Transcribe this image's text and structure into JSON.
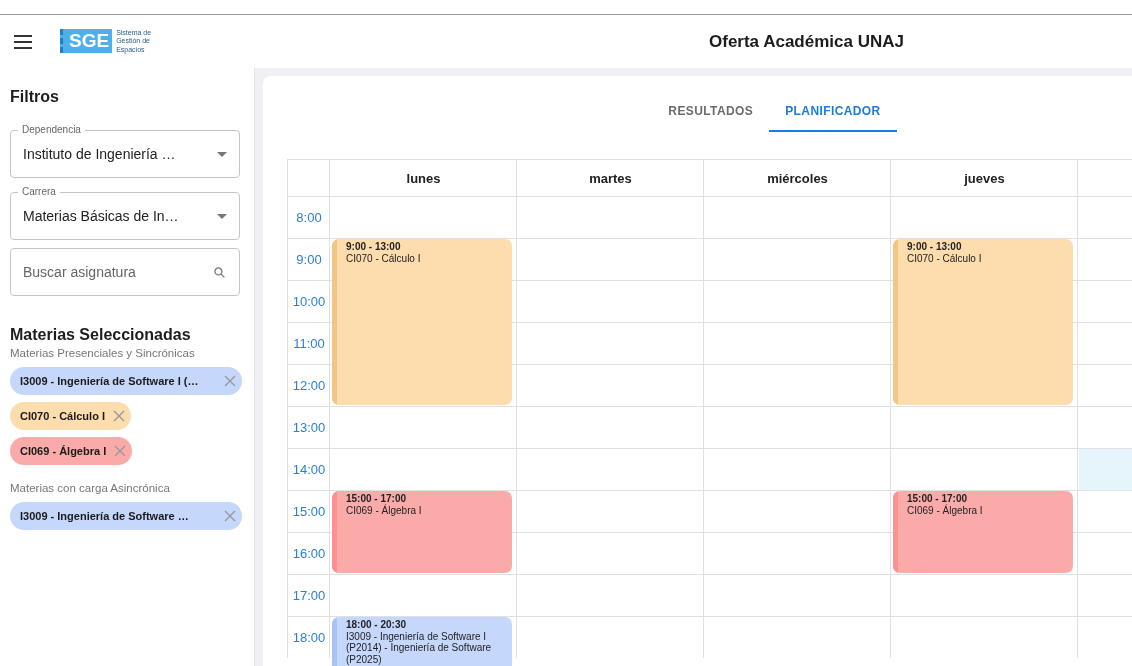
{
  "header": {
    "logo_text": "SGE",
    "logo_subtitle": "Sistema de Gestión de Espacios",
    "title": "Oferta Académica UNAJ"
  },
  "sidebar": {
    "title": "Filtros",
    "filters": [
      {
        "kind": "select",
        "label": "Dependencia",
        "value": "Instituto de Ingeniería  …"
      },
      {
        "kind": "select",
        "label": "Carrera",
        "value": "Materias Básicas de In…"
      },
      {
        "kind": "search",
        "placeholder": "Buscar asignatura"
      }
    ],
    "selected_title": "Materias Seleccionadas",
    "groups": [
      {
        "title": "Materias Presenciales y Sincrónicas",
        "chips": [
          {
            "label": "I3009 - Ingeniería de Software I (…",
            "color": "#c5d8fb"
          },
          {
            "label": "CI070 - Cálculo I",
            "color": "#fddcae"
          },
          {
            "label": "CI069 - Álgebra I",
            "color": "#fbaaaa"
          }
        ]
      },
      {
        "title": "Materias con carga Asincrónica",
        "chips": [
          {
            "label": "I3009 - Ingeniería de Software …",
            "color": "#c5d8fb"
          }
        ]
      }
    ]
  },
  "tabs": [
    {
      "label": "RESULTADOS",
      "selected": false
    },
    {
      "label": "PLANIFICADOR",
      "selected": true
    }
  ],
  "planner": {
    "hours": [
      {
        "label": "8:00",
        "last_column_highlighted": false
      },
      {
        "label": "9:00",
        "last_column_highlighted": false
      },
      {
        "label": "10:00",
        "last_column_highlighted": false
      },
      {
        "label": "11:00",
        "last_column_highlighted": false
      },
      {
        "label": "12:00",
        "last_column_highlighted": false
      },
      {
        "label": "13:00",
        "last_column_highlighted": false
      },
      {
        "label": "14:00",
        "last_column_highlighted": true
      },
      {
        "label": "15:00",
        "last_column_highlighted": false
      },
      {
        "label": "16:00",
        "last_column_highlighted": false
      },
      {
        "label": "17:00",
        "last_column_highlighted": false
      },
      {
        "label": "18:00",
        "last_column_highlighted": false
      }
    ],
    "days": [
      {
        "kind": "day",
        "label": "lunes",
        "events": [
          {
            "time": "9:00 - 13:00",
            "subject": "CI070 - Cálculo I",
            "color": "#fddcae"
          },
          {
            "time": "15:00 - 17:00",
            "subject": "CI069 - Álgebra I",
            "color": "#fbaaaa"
          },
          {
            "time": "18:00 - 20:30",
            "subject": "I3009 - Ingeniería de Software I (P2014) - Ingeniería de Software (P2025)",
            "color": "#c5d8fb"
          }
        ]
      },
      {
        "kind": "day",
        "label": "martes"
      },
      {
        "kind": "day",
        "label": "miércoles"
      },
      {
        "kind": "day",
        "label": "jueves",
        "events": [
          {
            "time": "9:00 - 13:00",
            "subject": "CI070 - Cálculo I",
            "color": "#fddcae"
          },
          {
            "time": "15:00 - 17:00",
            "subject": "CI069 - Álgebra I",
            "color": "#fbaaaa"
          }
        ]
      },
      {
        "kind": "unlabeled"
      }
    ]
  }
}
